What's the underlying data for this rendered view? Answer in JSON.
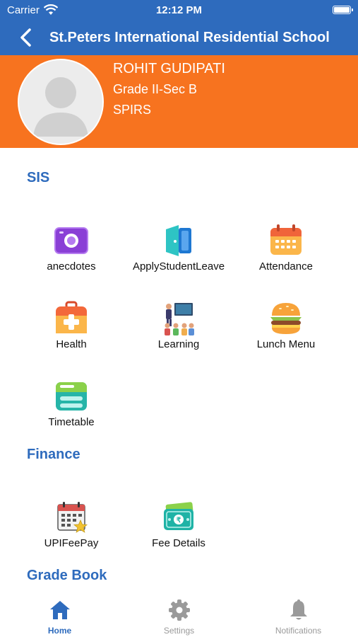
{
  "status_bar": {
    "carrier": "Carrier",
    "time": "12:12 PM"
  },
  "nav": {
    "title": "St.Peters International Residential School"
  },
  "profile": {
    "name": "ROHIT GUDIPATI",
    "grade": "Grade II-Sec B",
    "school": "SPIRS"
  },
  "sections": {
    "sis": "SIS",
    "finance": "Finance",
    "gradebook": "Grade Book"
  },
  "sis_items": [
    {
      "label": "anecdotes",
      "icon": "camera-icon"
    },
    {
      "label": "ApplyStudentLeave",
      "icon": "door-exit-icon"
    },
    {
      "label": "Attendance",
      "icon": "calendar-icon"
    },
    {
      "label": "Health",
      "icon": "first-aid-kit-icon"
    },
    {
      "label": "Learning",
      "icon": "classroom-icon"
    },
    {
      "label": "Lunch Menu",
      "icon": "burger-icon"
    },
    {
      "label": "Timetable",
      "icon": "timetable-icon"
    }
  ],
  "finance_items": [
    {
      "label": "UPIFeePay",
      "icon": "calendar-pay-icon"
    },
    {
      "label": "Fee Details",
      "icon": "money-icon"
    }
  ],
  "tabs": [
    {
      "label": "Home",
      "icon": "home-icon",
      "active": true
    },
    {
      "label": "Settings",
      "icon": "gear-icon",
      "active": false
    },
    {
      "label": "Notifications",
      "icon": "bell-icon",
      "active": false
    }
  ],
  "colors": {
    "primary": "#2e6bbd",
    "profile_bg": "#f7731f"
  }
}
